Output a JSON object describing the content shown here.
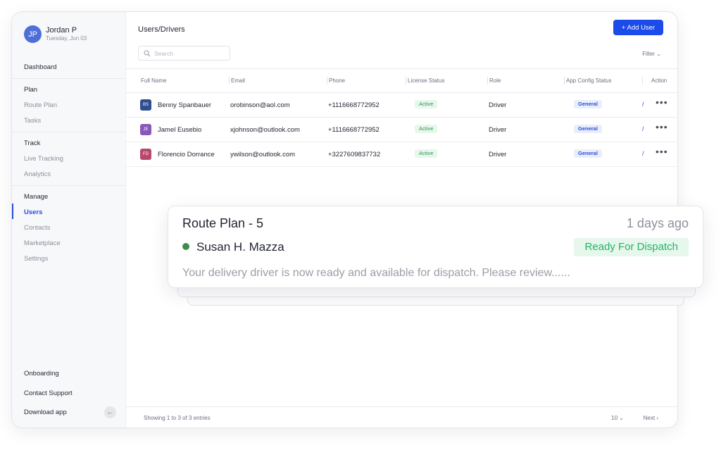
{
  "user": {
    "initials": "JP",
    "name": "Jordan P",
    "date": "Tuesday, Jun 03"
  },
  "sidebar": {
    "dashboard": "Dashboard",
    "plan": {
      "heading": "Plan",
      "items": [
        "Route Plan",
        "Tasks"
      ]
    },
    "track": {
      "heading": "Track",
      "items": [
        "Live Tracking",
        "Analytics"
      ]
    },
    "manage": {
      "heading": "Manage",
      "items": [
        "Users",
        "Contacts",
        "Marketplace",
        "Settings"
      ]
    },
    "bottom": [
      "Onboarding",
      "Contact Support",
      "Download app"
    ],
    "collapse_icon": "←"
  },
  "header": {
    "title": "Users/Drivers",
    "add_button": "+ Add User",
    "search_placeholder": "Search",
    "filter": "Filter ⌄"
  },
  "table": {
    "columns": [
      "Full Name",
      "Email",
      "Phone",
      "License Status",
      "Role",
      "App Config Status",
      "Action"
    ],
    "rows": [
      {
        "initials": "BS",
        "color": "#2d4f8f",
        "name": "Benny Spanbauer",
        "email": "orobinson@aol.com",
        "phone": "+1116668772952",
        "license": "Active",
        "role": "Driver",
        "config": "General",
        "extra": "/",
        "action": "•••"
      },
      {
        "initials": "JE",
        "color": "#8a58b8",
        "name": "Jamel Eusebio",
        "email": "xjohnson@outlook.com",
        "phone": "+1116668772952",
        "license": "Active",
        "role": "Driver",
        "config": "General",
        "extra": "/",
        "action": "•••"
      },
      {
        "initials": "FD",
        "color": "#b8486b",
        "name": "Florencio Dorrance",
        "email": "ywilson@outlook.com",
        "phone": "+3227609837732",
        "license": "Active",
        "role": "Driver",
        "config": "General",
        "extra": "/",
        "action": "•••"
      }
    ]
  },
  "footer": {
    "showing": "Showing 1 to 3 of 3 entries",
    "per_page": "10 ⌄",
    "next": "Next ›"
  },
  "notification": {
    "title": "Route Plan - 5",
    "time": "1 days ago",
    "name": "Susan H. Mazza",
    "status": "Ready For Dispatch",
    "message": "Your delivery driver is now ready and available for dispatch. Please review......"
  }
}
